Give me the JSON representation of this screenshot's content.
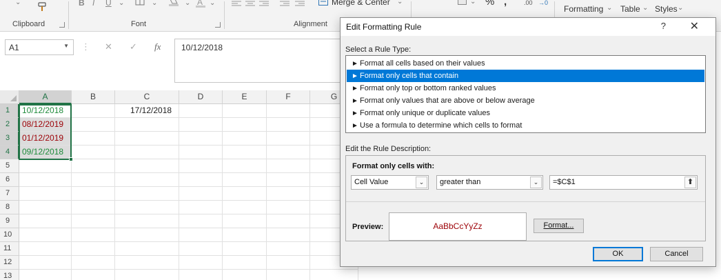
{
  "ribbon": {
    "groups": {
      "clipboard": "Clipboard",
      "font": "Font",
      "alignment": "Alignment"
    },
    "merge_center": "Merge & Center",
    "percent_symbol": "%",
    "comma_symbol": "9",
    "conditional_formatting": "Formatting",
    "format_as_table": "Table",
    "cell_styles": "Styles",
    "bold": "B",
    "italic": "I",
    "underline": "U"
  },
  "formula_bar": {
    "name_box": "A1",
    "cancel_symbol": "✕",
    "enter_symbol": "✓",
    "fx_symbol": "fx",
    "value": "10/12/2018"
  },
  "sheet": {
    "columns": [
      "A",
      "B",
      "C",
      "D",
      "E",
      "F",
      "G"
    ],
    "rows": [
      "1",
      "2",
      "3",
      "4",
      "5",
      "6",
      "7",
      "8",
      "9",
      "10",
      "11",
      "12",
      "13"
    ],
    "cells": {
      "A1": "10/12/2018",
      "A2": "08/12/2019",
      "A3": "01/12/2019",
      "A4": "09/12/2018",
      "C1": "17/12/2018"
    },
    "colors": {
      "green_text": "#1e8a3a",
      "red_text": "#9c0006",
      "selection": "#217346"
    }
  },
  "dialog": {
    "title": "Edit Formatting Rule",
    "help": "?",
    "close": "✕",
    "select_rule_type_label": "Select a Rule Type:",
    "rule_types": [
      "Format all cells based on their values",
      "Format only cells that contain",
      "Format only top or bottom ranked values",
      "Format only values that are above or below average",
      "Format only unique or duplicate values",
      "Use a formula to determine which cells to format"
    ],
    "selected_rule_index": 1,
    "edit_rule_desc_label": "Edit the Rule Description:",
    "format_only_cells_with": "Format only cells with:",
    "condition_type": "Cell Value",
    "operator": "greater than",
    "operand": "=$C$1",
    "preview_label": "Preview:",
    "preview_sample": "AaBbCcYyZz",
    "format_button": "Format...",
    "ok_button": "OK",
    "cancel_button": "Cancel",
    "accent": "#0078d7"
  }
}
